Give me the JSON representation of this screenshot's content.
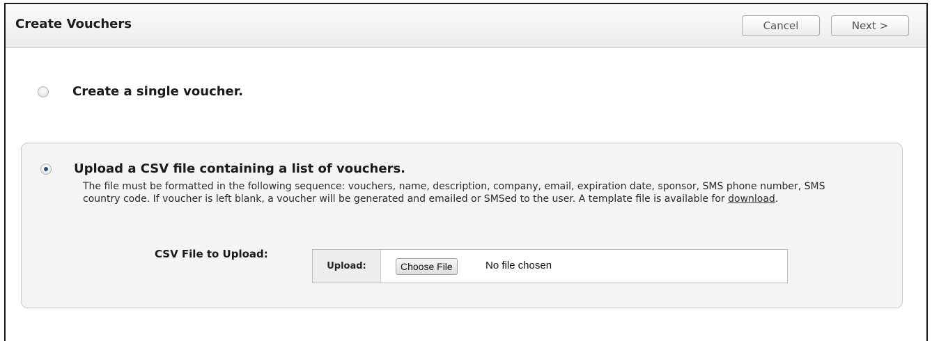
{
  "header": {
    "title": "Create Vouchers",
    "cancel_label": "Cancel",
    "next_label": "Next >"
  },
  "options": {
    "single": {
      "label": "Create a single voucher.",
      "selected": false
    },
    "csv": {
      "label": "Upload a CSV file containing a list of vouchers.",
      "selected": true
    }
  },
  "csv": {
    "description_before_link": "The file must be formatted in the following sequence: vouchers, name, description, company, email, expiration date, sponsor, SMS phone number, SMS country code. If voucher is left blank, a voucher will be generated and emailed or SMSed to the user. A template file is available for ",
    "download_link": "download",
    "description_after_link": ".",
    "field_label": "CSV File to Upload:",
    "upload_tag": "Upload:",
    "choose_file_label": "Choose File",
    "file_status": "No file chosen"
  }
}
